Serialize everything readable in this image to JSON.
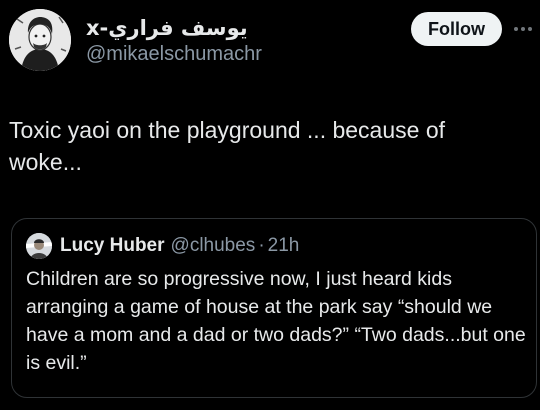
{
  "author": {
    "display_name": "يوسف فراري-x",
    "handle": "@mikaelschumachr",
    "avatar_icon": "profile-avatar"
  },
  "header": {
    "follow_label": "Follow",
    "more_icon": "ellipsis-icon"
  },
  "tweet": {
    "text": "Toxic yaoi on the playground ... because of woke..."
  },
  "quote": {
    "author_name": "Lucy Huber",
    "author_handle": "@clhubes",
    "separator": "·",
    "timestamp": "21h",
    "text": "Children are so progressive now, I just heard kids arranging a game of house at the park say “should we have a mom and a dad or two dads?” “Two dads...but one is evil.”",
    "avatar_icon": "profile-avatar"
  },
  "colors": {
    "background": "#000000",
    "text_primary": "#e7e9ea",
    "text_secondary": "#8b98a5",
    "border": "#2f3336",
    "follow_bg": "#eff3f4"
  }
}
